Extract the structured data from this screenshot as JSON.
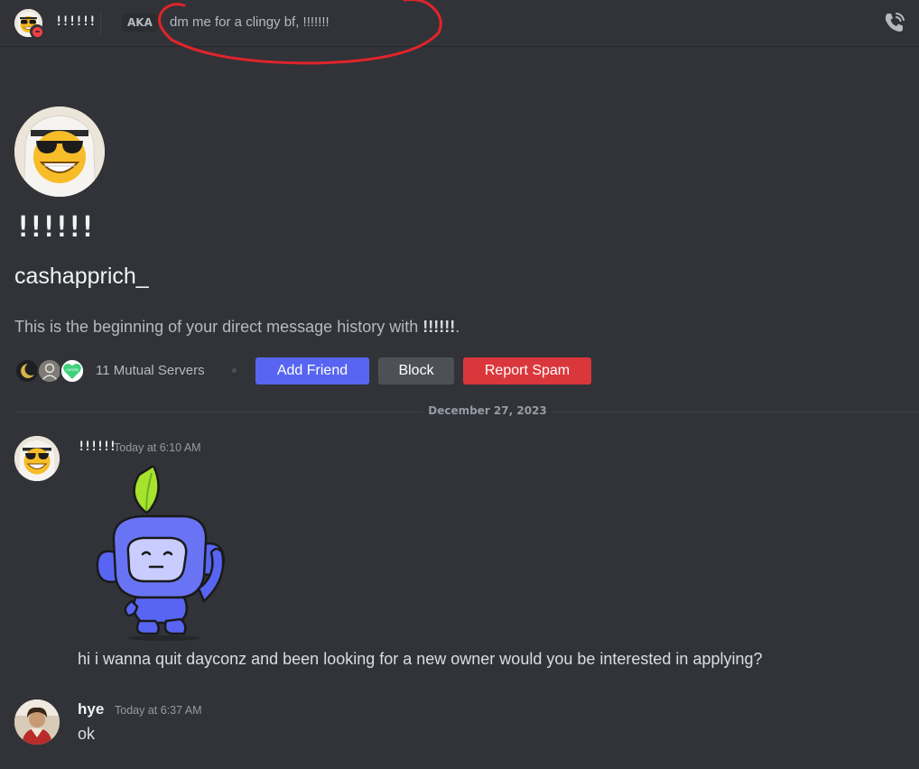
{
  "header": {
    "display_name": "!!!!!!",
    "aka_label": "AKA",
    "aka_names": "dm me for a clingy bf, !!!!!!!",
    "call_icon": "phone-call-icon"
  },
  "intro": {
    "display_name": "!!!!!!",
    "username": "cashapprich_",
    "beginning_prefix": "This is the beginning of your direct message history with ",
    "beginning_name": "!!!!!!",
    "beginning_suffix": ".",
    "mutual_servers": "11 Mutual Servers",
    "mutual_server_badge": "conda",
    "buttons": {
      "add_friend": "Add Friend",
      "block": "Block",
      "report_spam": "Report Spam"
    }
  },
  "date_divider": "December 27, 2023",
  "messages": [
    {
      "author": "!!!!!!",
      "time": "Today at 6:10 AM",
      "sticker": "wumpus-waving-sticker",
      "text": "hi i wanna quit dayconz and been looking for a new owner would you be interested in applying?"
    },
    {
      "author": "hye",
      "time": "Today at 6:37 AM",
      "text": "ok"
    }
  ],
  "colors": {
    "background": "#313338",
    "blurple": "#5865f2",
    "danger": "#da373c",
    "secondary": "#4e5058",
    "annotation_circle": "#e0242b"
  }
}
